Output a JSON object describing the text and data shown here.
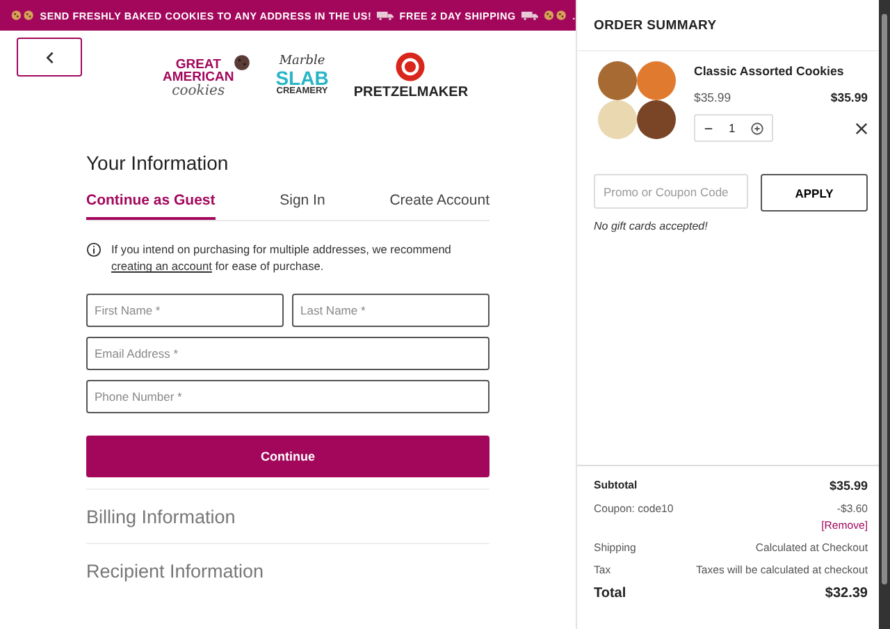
{
  "banner": {
    "parts": [
      {
        "kind": "cookies"
      },
      {
        "kind": "text",
        "text": "SEND FRESHLY BAKED COOKIES TO ANY ADDRESS IN THE US!"
      },
      {
        "kind": "truck"
      },
      {
        "kind": "text",
        "text": "FREE 2 DAY SHIPPING"
      },
      {
        "kind": "truck"
      },
      {
        "kind": "cookies"
      },
      {
        "kind": "text",
        "text": "."
      }
    ]
  },
  "logos": [
    {
      "kind": "gac",
      "lines": [
        "GREAT",
        "AMERICAN",
        "cookies"
      ]
    },
    {
      "kind": "slab",
      "lines": [
        "Marble",
        "SLAB",
        "CREAMERY"
      ]
    },
    {
      "kind": "pretzel",
      "lines": [
        "PRETZELMAKER"
      ]
    }
  ],
  "info": {
    "title": "Your Information",
    "tabs": [
      {
        "label": "Continue as Guest",
        "selected": true
      },
      {
        "label": "Sign In",
        "selected": false
      },
      {
        "label": "Create Account",
        "selected": false
      }
    ],
    "notice": {
      "before": "If you intend on purchasing for multiple addresses, we recommend",
      "link": "creating an account",
      "after": "for ease of purchase."
    },
    "fields": [
      {
        "placeholder": "First Name *",
        "kind": "half"
      },
      {
        "placeholder": "Last Name *",
        "kind": "half"
      },
      {
        "placeholder": "Email Address *",
        "kind": "full"
      },
      {
        "placeholder": "Phone Number *",
        "kind": "full"
      }
    ],
    "button": "Continue"
  },
  "sections": [
    "Billing Information",
    "Recipient Information"
  ],
  "summary": {
    "title": "ORDER SUMMARY",
    "item": {
      "name": "Classic Assorted Cookies",
      "unit_price": "$35.99",
      "line_total": "$35.99",
      "quantity": "1"
    },
    "promo": {
      "placeholder": "Promo or Coupon Code",
      "button": "APPLY",
      "note": "No gift cards accepted!"
    },
    "rows": [
      {
        "kind": "bold",
        "label": "Subtotal",
        "value": "$35.99"
      },
      {
        "kind": "coupon",
        "label": "Coupon: code10",
        "value": "-$3.60",
        "action": "[Remove]"
      },
      {
        "kind": "plain",
        "label": "Shipping",
        "value": "Calculated at Checkout"
      },
      {
        "kind": "plain",
        "label": "Tax",
        "value": "Taxes will be calculated at checkout"
      },
      {
        "kind": "total",
        "label": "Total",
        "value": "$32.39"
      }
    ]
  }
}
